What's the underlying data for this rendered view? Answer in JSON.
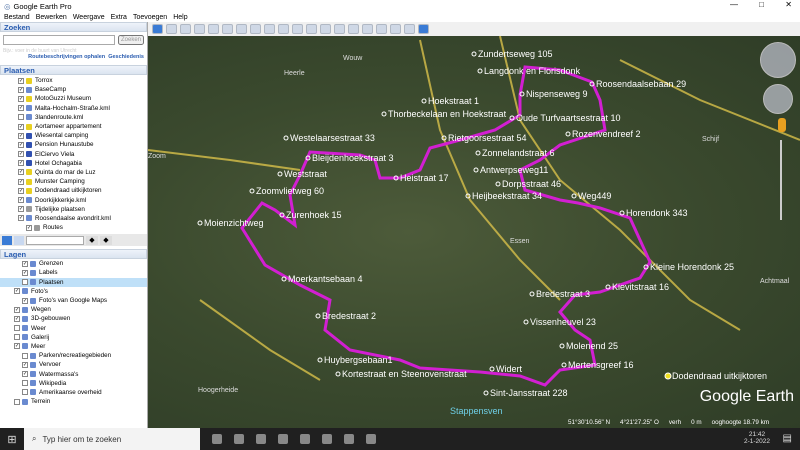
{
  "window": {
    "title": "Google Earth Pro",
    "minimize": "—",
    "maximize": "□",
    "close": "✕"
  },
  "menu": [
    "Bestand",
    "Bewerken",
    "Weergave",
    "Extra",
    "Toevoegen",
    "Help"
  ],
  "search": {
    "header": "Zoeken",
    "button": "Zoeken",
    "placeholder": "",
    "hint": "Bijv.: voer in de buurt van Utrecht",
    "link1": "Routebeschrijvingen ophalen",
    "link2": "Geschiedenis"
  },
  "places": {
    "header": "Plaatsen",
    "items": [
      {
        "label": "Torrox",
        "checked": true,
        "icon": "pin-yellow"
      },
      {
        "label": "BaseCamp",
        "checked": true,
        "icon": "kml"
      },
      {
        "label": "MotoGuzzi Museum",
        "checked": true,
        "icon": "pin-yellow"
      },
      {
        "label": "Malta-Hochalm-Straße.kml",
        "checked": true,
        "icon": "kml"
      },
      {
        "label": "3landenroute.kml",
        "checked": false,
        "icon": "kml"
      },
      {
        "label": "Aortameer appartement",
        "checked": true,
        "icon": "pin-yellow"
      },
      {
        "label": "Wiesental camping",
        "checked": true,
        "icon": "pin-blue"
      },
      {
        "label": "Pension Hunaustube",
        "checked": true,
        "icon": "pin-blue"
      },
      {
        "label": "ElCiervo Viela",
        "checked": true,
        "icon": "pin-blue"
      },
      {
        "label": "Hotel Ochagabia",
        "checked": true,
        "icon": "pin-blue"
      },
      {
        "label": "Quinta do mar de Luz",
        "checked": true,
        "icon": "pin-yellow"
      },
      {
        "label": "Munster Camping",
        "checked": true,
        "icon": "pin-yellow"
      },
      {
        "label": "Dodendraad uitkijktoren",
        "checked": true,
        "icon": "pin-yellow"
      },
      {
        "label": "Doorkijkkerkje.kml",
        "checked": true,
        "icon": "kml"
      },
      {
        "label": "Tijdelijke plaatsen",
        "checked": true,
        "icon": "folder"
      },
      {
        "label": "Roosendaalse avondrit.kml",
        "checked": true,
        "icon": "kml"
      },
      {
        "label": "Routes",
        "checked": true,
        "icon": "folder"
      }
    ]
  },
  "layers": {
    "header": "Lagen",
    "items": [
      {
        "label": "Grenzen",
        "checked": true
      },
      {
        "label": "Labels",
        "checked": true
      },
      {
        "label": "Plaatsen",
        "checked": false,
        "selected": true
      },
      {
        "label": "Foto's",
        "checked": true
      },
      {
        "label": "Foto's van Google Maps",
        "checked": true
      },
      {
        "label": "Wegen",
        "checked": true
      },
      {
        "label": "3D-gebouwen",
        "checked": true
      },
      {
        "label": "Weer",
        "checked": false
      },
      {
        "label": "Galerij",
        "checked": false
      },
      {
        "label": "Meer",
        "checked": true
      },
      {
        "label": "Parken/recreatiegebieden",
        "checked": false
      },
      {
        "label": "Vervoer",
        "checked": true
      },
      {
        "label": "Watermassa's",
        "checked": true
      },
      {
        "label": "Wikipedia",
        "checked": false
      },
      {
        "label": "Amerikaanse overheid",
        "checked": false
      },
      {
        "label": "Terrein",
        "checked": false
      }
    ]
  },
  "map": {
    "route_color": "#d21fd2",
    "labels": [
      "Zundertseweg 105",
      "Langdonk en Florisdonk",
      "Roosendaalsebaan 29",
      "Nispenseweg 9",
      "Hoekstraat 1",
      "Thorbeckelaan en Hoekstraat",
      "Oude Turfvaartsestraat 10",
      "Westelaarsestraat 33",
      "Rietgoorsestraat 54",
      "Rozenvendreef 2",
      "Zonnelandstraat 6",
      "Bleijdenhoekstraat 3",
      "Antwerpseweg11",
      "Weststraat",
      "Heistraat 17",
      "Dorpsstraat 46",
      "Zoomvlietweg 60",
      "Heijbeekstraat 34",
      "Weg449",
      "Zurenhoek 15",
      "Horendonk 343",
      "Moienzichtweg",
      "Kleine Horendonk 25",
      "Moerkantsebaan 4",
      "Kievitstraat 16",
      "Bredestraat 3",
      "Bredestraat 2",
      "Vissenheuvel 23",
      "Molenend 25",
      "Huybergsebaan1",
      "Mertensgreef 16",
      "Kortestraat en Steenovenstraat",
      "Widert",
      "Sint-Jansstraat 228",
      "Dodendraad uitkijktoren"
    ],
    "towns": [
      "Heerle",
      "Wouw",
      "Essen",
      "Hoogerheide",
      "Stappensven",
      "Achtmaal",
      "Schijf",
      "Zoom"
    ],
    "logo": "Google Earth",
    "status": {
      "lat": "51°30'10.56\" N",
      "lon": "4°21'27.25\" O",
      "elev_label": "verh",
      "elev": "0 m",
      "eye": "ooghoogte  18.79 km"
    }
  },
  "taskbar": {
    "search_placeholder": "Typ hier om te zoeken",
    "time": "21:42",
    "date": "2-1-2022"
  }
}
